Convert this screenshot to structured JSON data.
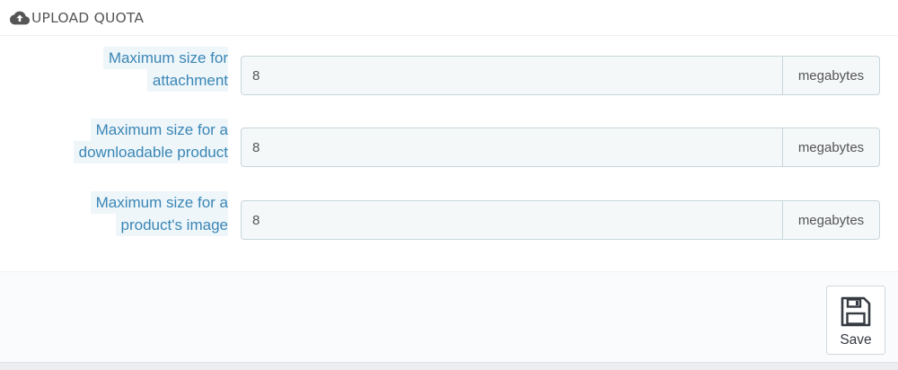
{
  "panel": {
    "title": "UPLOAD QUOTA",
    "icon": "cloud-upload-icon"
  },
  "fields": [
    {
      "label_lines": [
        "Maximum size for",
        "attachment"
      ],
      "value": "8",
      "unit": "megabytes"
    },
    {
      "label_lines": [
        "Maximum size for a",
        "downloadable product"
      ],
      "value": "8",
      "unit": "megabytes"
    },
    {
      "label_lines": [
        "Maximum size for a",
        "product's image"
      ],
      "value": "8",
      "unit": "megabytes"
    }
  ],
  "footer": {
    "save_label": "Save",
    "save_icon": "floppy-disk-icon"
  },
  "colors": {
    "label_text": "#3a86b5",
    "label_bg": "#eef6fa",
    "input_bg": "#f5f8f9",
    "input_border": "#c7d6db"
  }
}
